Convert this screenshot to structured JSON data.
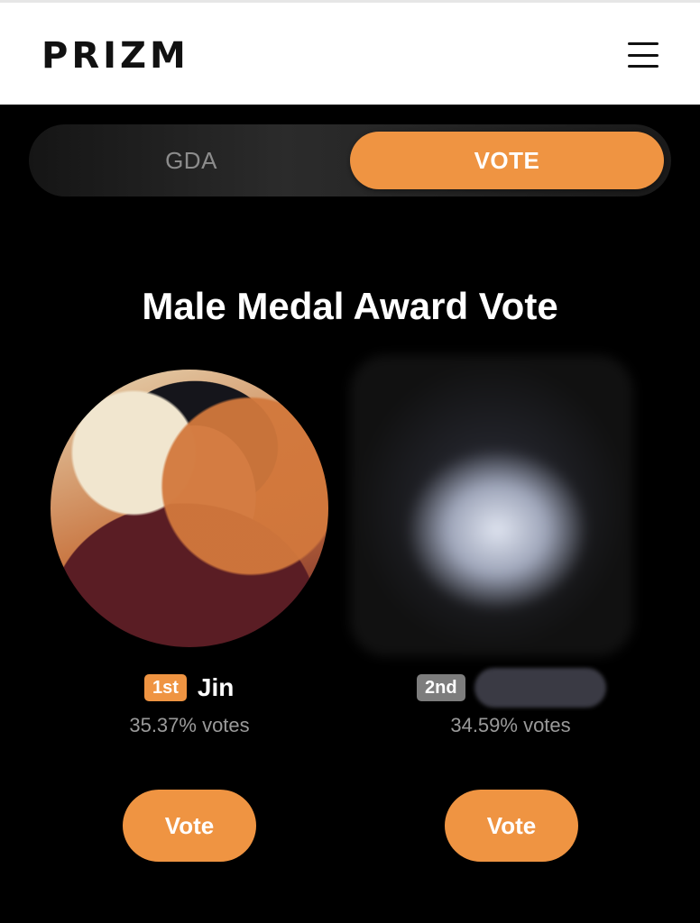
{
  "header": {
    "logo": "PRIZM",
    "menu_icon": "hamburger-menu-icon"
  },
  "tabs": [
    {
      "label": "GDA",
      "active": false
    },
    {
      "label": "VOTE",
      "active": true
    }
  ],
  "page_title": "Male Medal Award Vote",
  "candidates": [
    {
      "rank": "1st",
      "name": "Jin",
      "votes": "35.37% votes",
      "button": "Vote"
    },
    {
      "rank": "2nd",
      "name": "",
      "votes": "34.59% votes",
      "button": "Vote"
    }
  ],
  "colors": {
    "accent": "#ef9442",
    "rank2_badge": "#7d7d7d",
    "background": "#000000"
  }
}
